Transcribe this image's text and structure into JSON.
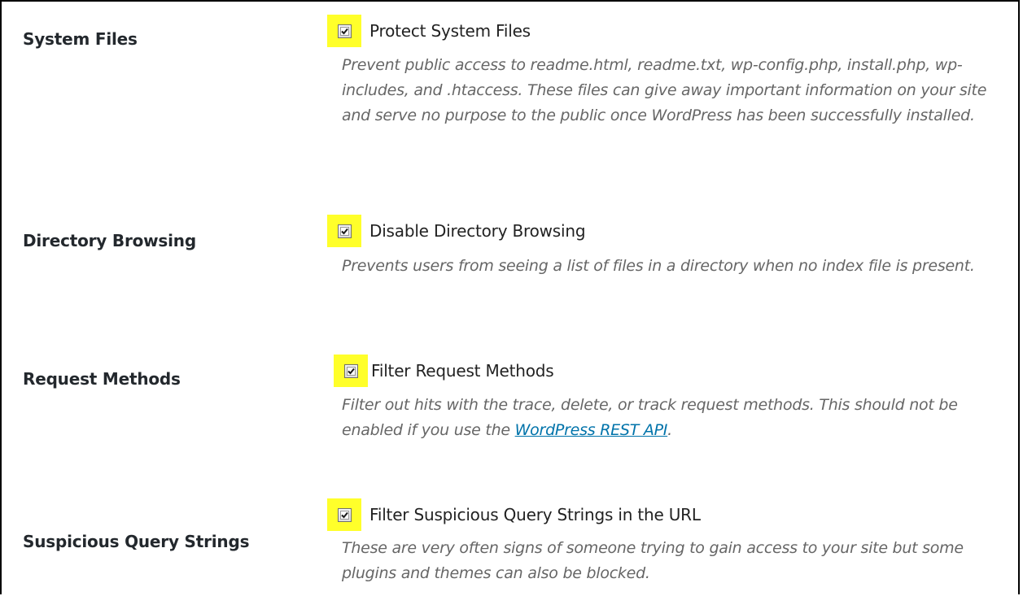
{
  "settings": [
    {
      "label": "System Files",
      "option_label": "Protect System Files",
      "checked": true,
      "description": "Prevent public access to readme.html, readme.txt, wp-config.php, install.php, wp-includes, and .htaccess. These files can give away important information on your site and serve no purpose to the public once WordPress has been successfully installed."
    },
    {
      "label": "Directory Browsing",
      "option_label": "Disable Directory Browsing",
      "checked": true,
      "description": "Prevents users from seeing a list of files in a directory when no index file is present."
    },
    {
      "label": "Request Methods",
      "option_label": "Filter Request Methods",
      "checked": true,
      "description_before": "Filter out hits with the trace, delete, or track request methods. This should not be enabled if you use the ",
      "description_link": "WordPress REST API",
      "description_after": "."
    },
    {
      "label": "Suspicious Query Strings",
      "option_label": "Filter Suspicious Query Strings in the URL",
      "checked": true,
      "description": "These are very often signs of someone trying to gain access to your site but some plugins and themes can also be blocked."
    }
  ],
  "colors": {
    "highlight": "#ffff2a",
    "link": "#0073aa",
    "description": "#666666"
  }
}
